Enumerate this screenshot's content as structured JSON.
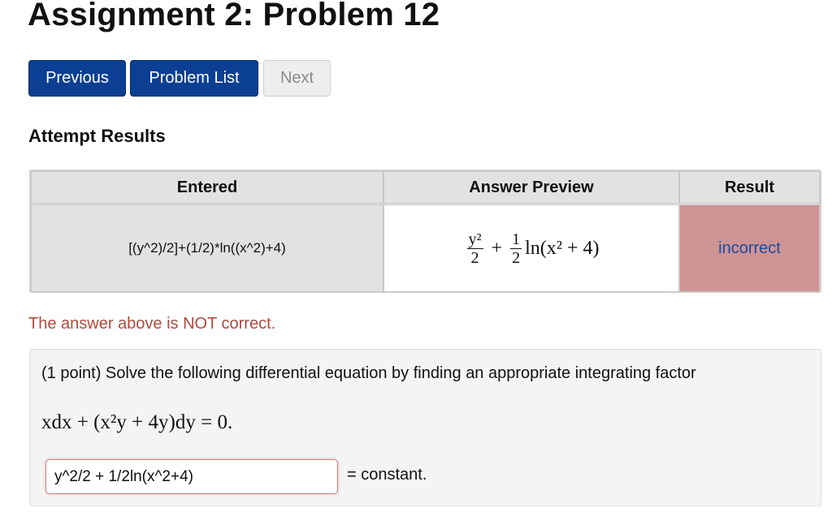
{
  "title": "Assignment 2: Problem 12",
  "nav": {
    "previous": "Previous",
    "problem_list": "Problem List",
    "next": "Next"
  },
  "attempt_heading": "Attempt Results",
  "results_table": {
    "headers": [
      "Entered",
      "Answer Preview",
      "Result"
    ],
    "row": {
      "entered": "[(y^2)/2]+(1/2)*ln((x^2)+4)",
      "preview": {
        "frac1_num": "y²",
        "frac1_den": "2",
        "plus": "+",
        "frac2_num": "1",
        "frac2_den": "2",
        "ln_expr": "ln(x² + 4)"
      },
      "result": "incorrect"
    }
  },
  "feedback": "The answer above is NOT correct.",
  "problem": {
    "text": "(1 point) Solve the following differential equation by finding an appropriate integrating factor",
    "equation": "xdx + (x²y + 4y)dy = 0.",
    "answer_value": "y^2/2 + 1/2ln(x^2+4)",
    "suffix": "= constant."
  },
  "colors": {
    "button_primary": "#0a3f93",
    "incorrect_bg": "#cf9393",
    "incorrect_text": "#1a4a9e",
    "feedback_text": "#b04a3c"
  }
}
